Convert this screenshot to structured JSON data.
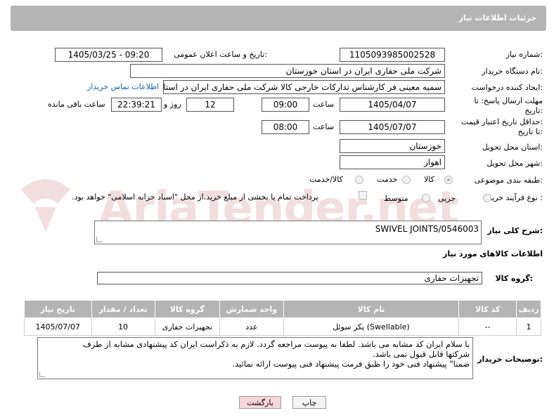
{
  "header": {
    "title": "جزئیات اطلاعات نیاز"
  },
  "watermark": {
    "text": "AriaTender.net"
  },
  "form": {
    "need_number": {
      "label": "شماره نیاز:",
      "value": "1105093985002528"
    },
    "announce": {
      "label": "تاریخ و ساعت اعلان عمومی:",
      "value": "1405/03/25 - 09:20"
    },
    "buyer_org": {
      "label": "نام دستگاه خریدار:",
      "value": "شرکت ملی حفاری ایران در استان خوزستان"
    },
    "creator": {
      "label": "ایجاد کننده درخواست:",
      "value": "سمیه معینی فر کارشناس تدارکات خارجی کالا شرکت ملی حفاری ایران در استان خوزستان",
      "contact_link": "اطلاعات تماس خریدار"
    },
    "deadline": {
      "label_line1": "مهلت ارسال پاسخ: تا",
      "label_line2": "تاریخ:",
      "date": "1405/04/07",
      "time_label": "ساعت",
      "time": "09:00",
      "days": "12",
      "days_label": "روز و",
      "remaining": "22:39:21",
      "remaining_label": "ساعت باقی مانده"
    },
    "price_validity": {
      "label_line1": "حداقل تاریخ اعتبار قیمت:",
      "label_line2": "تا تاریخ:",
      "date": "1405/07/07",
      "time_label": "ساعت",
      "time": "08:00"
    },
    "province": {
      "label": "استان محل تحویل:",
      "value": "خوزستان"
    },
    "city": {
      "label": "شهر محل تحویل:",
      "value": "اهواز"
    },
    "category": {
      "label": "طبقه بندی موضوعی:",
      "options": [
        "کالا",
        "خدمت",
        "کالا/خدمت"
      ],
      "selected": "کالا"
    },
    "process": {
      "label": "نوع فرآیند خرید :",
      "options": [
        "جزیی",
        "متوسط"
      ],
      "note": "پرداخت تمام یا بخشی از مبلغ خرید،از محل \"اسناد خزانه اسلامی\" خواهد بود."
    }
  },
  "summary": {
    "label": "شرح کلی نیاز:",
    "value": "SWIVEL JOINTS/0546003"
  },
  "goods_section": {
    "title": "اطلاعات کالاهای مورد نیاز"
  },
  "goods_group": {
    "label": "گروه کالا:",
    "value": "تجهیزات حفاری"
  },
  "table": {
    "headers": [
      "ردیف",
      "کد کالا",
      "نام کالا",
      "واحد شمارش",
      "گروه کالا",
      "تعداد / مقدار",
      "تاریخ نیاز"
    ],
    "rows": [
      [
        "1",
        "--",
        "پکر سوئل (Swellable)",
        "عدد",
        "تجهیزات حفاری",
        "10",
        "1405/07/07"
      ]
    ]
  },
  "buyer_notes": {
    "label": "توضیحات خریدار:",
    "line1": "با سلام ایران کد مشابه می باشد. لطفا به پیوست مراجعه گردد. لازم به ذکراست ایران کد پیشنهادی مشابه از طرف",
    "line2": "شرکتها قابل قبول نمی باشد.",
    "line3": "ضمنا\" پیشنهاد فنی خود را طبق فرمت پیشنهاد فنی پیوست ارائه نمائید."
  },
  "buttons": {
    "print": "چاپ",
    "back": "بازگشت"
  },
  "colors": {
    "header_bg": "#b4b4b4",
    "link": "#1a5fb4",
    "back_button": "#f8d7da"
  }
}
